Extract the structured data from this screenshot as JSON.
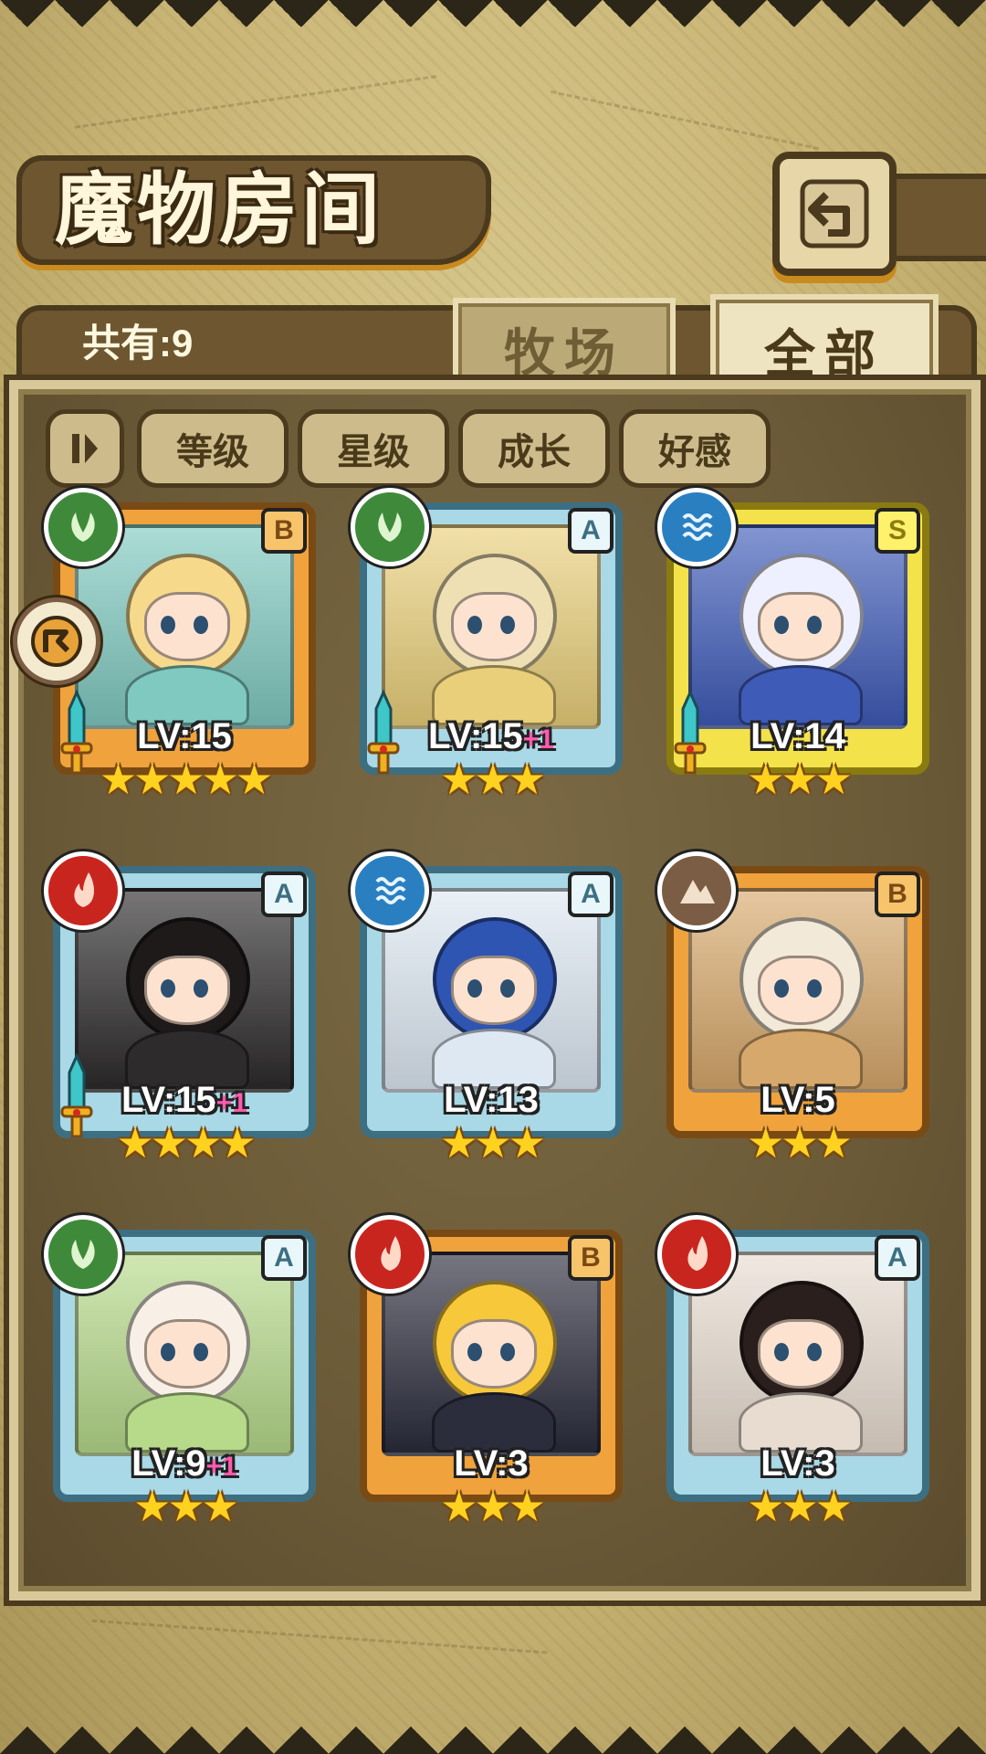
{
  "header": {
    "title": "魔物房间",
    "back_icon": "back-return-icon"
  },
  "status": {
    "count_label": "共有:9"
  },
  "tabs": [
    {
      "label": "牧场",
      "active": false
    },
    {
      "label": "全部",
      "active": true
    }
  ],
  "sort": {
    "toggle_icon": "sort-order-icon",
    "buttons": [
      {
        "label": "等级"
      },
      {
        "label": "星级"
      },
      {
        "label": "成长"
      },
      {
        "label": "好感"
      }
    ]
  },
  "monsters": [
    {
      "rank": "B",
      "element": "grass",
      "level": "LV:15",
      "bonus": "",
      "stars": 5,
      "equipped": true,
      "colors": {
        "hair": "#f6d98a",
        "outfit": "#7fc9c0"
      }
    },
    {
      "rank": "A",
      "element": "grass",
      "level": "LV:15",
      "bonus": "+1",
      "stars": 3,
      "equipped": true,
      "colors": {
        "hair": "#efe0b4",
        "outfit": "#e9cf7a"
      }
    },
    {
      "rank": "S",
      "element": "water",
      "level": "LV:14",
      "bonus": "",
      "stars": 3,
      "equipped": true,
      "colors": {
        "hair": "#eef0ff",
        "outfit": "#3f5bb8"
      }
    },
    {
      "rank": "A",
      "element": "fire",
      "level": "LV:15",
      "bonus": "+1",
      "stars": 4,
      "equipped": true,
      "colors": {
        "hair": "#1e1a1a",
        "outfit": "#2d2b2b"
      }
    },
    {
      "rank": "A",
      "element": "water",
      "level": "LV:13",
      "bonus": "",
      "stars": 3,
      "equipped": false,
      "colors": {
        "hair": "#2f55b3",
        "outfit": "#dde8f2"
      }
    },
    {
      "rank": "B",
      "element": "earth",
      "level": "LV:5",
      "bonus": "",
      "stars": 3,
      "equipped": false,
      "colors": {
        "hair": "#f3e9d8",
        "outfit": "#d7a86b"
      }
    },
    {
      "rank": "A",
      "element": "grass",
      "level": "LV:9",
      "bonus": "+1",
      "stars": 3,
      "equipped": false,
      "colors": {
        "hair": "#f8f0e6",
        "outfit": "#b6d98a"
      }
    },
    {
      "rank": "B",
      "element": "fire",
      "level": "LV:3",
      "bonus": "",
      "stars": 3,
      "equipped": false,
      "colors": {
        "hair": "#f7c83a",
        "outfit": "#2b2c3c"
      }
    },
    {
      "rank": "A",
      "element": "fire",
      "level": "LV:3",
      "bonus": "",
      "stars": 3,
      "equipped": false,
      "colors": {
        "hair": "#2a1f1c",
        "outfit": "#e8dcd0"
      }
    }
  ],
  "team_badge_icon": "team-marker-icon"
}
